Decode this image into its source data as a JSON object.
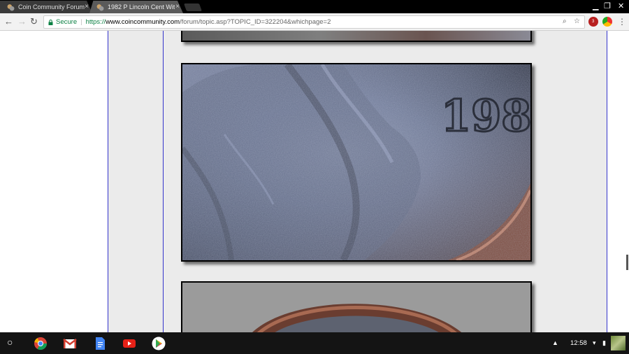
{
  "tabs": [
    {
      "title": "Coin Community Forum",
      "close": "×",
      "active": false
    },
    {
      "title": "1982 P Lincoln Cent With",
      "close": "×",
      "active": true
    }
  ],
  "window_controls": {
    "minimize": "▁",
    "restore": "❐",
    "close": "✕"
  },
  "toolbar": {
    "back": "←",
    "forward": "→",
    "reload": "↻",
    "secure_label": "Secure",
    "separator": "|",
    "url_scheme": "https://",
    "url_host": "www.coincommunity.com",
    "url_path": "/forum/topic.asp?TOPIC_ID=322204&whichpage=2",
    "zoom_icon": "⌕",
    "bookmark_icon": "☆",
    "extension_badge": "3",
    "menu_icon": "⋮"
  },
  "photo_main": {
    "date_digits": "198"
  },
  "shelf": {
    "launcher": "○",
    "clock": "12:58",
    "notification_icon": "▲",
    "wifi_icon": "▾",
    "battery_icon": "▮"
  },
  "colors": {
    "secure_green": "#0b8043",
    "column_line": "#3333cc",
    "content_bg": "#ebebeb"
  }
}
